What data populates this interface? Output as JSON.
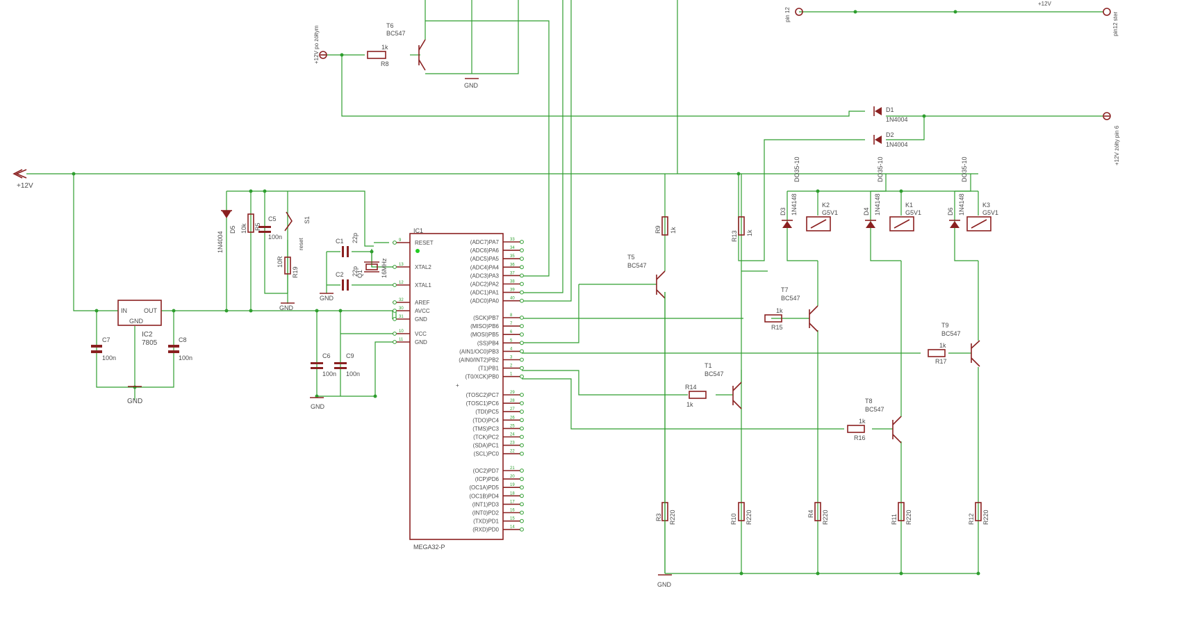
{
  "colors": {
    "wire": "#2e9e2e",
    "part": "#8a2020",
    "text": "#4a4a4a",
    "background": "#ffffff"
  },
  "power": {
    "supply": "+12V",
    "gnd": "GND"
  },
  "connectors": {
    "in_left": "+12V po żółtym",
    "in_right": "+12V żółty pin 6",
    "top_right_a": "pin 12",
    "top_right_b": "pin12 ster",
    "top_right_c": "+12V"
  },
  "ic1": {
    "name": "IC1",
    "part": "MEGA32-P",
    "left_pins": [
      "RESET",
      "XTAL2",
      "XTAL1",
      "AREF",
      "AVCC",
      "GND",
      "VCC",
      "GND"
    ],
    "right_pins": [
      "(ADC7)PA7",
      "(ADC6)PA6",
      "(ADC5)PA5",
      "(ADC4)PA4",
      "(ADC3)PA3",
      "(ADC2)PA2",
      "(ADC1)PA1",
      "(ADC0)PA0",
      "(SCK)PB7",
      "(MISO)PB6",
      "(MOSI)PB5",
      "(SS)PB4",
      "(AIN1/OC0)PB3",
      "(AIN0/INT2)PB2",
      "(T1)PB1",
      "(T0/XCK)PB0",
      "(TOSC2)PC7",
      "(TOSC1)PC6",
      "(TDI)PC5",
      "(TDO)PC4",
      "(TMS)PC3",
      "(TCK)PC2",
      "(SDA)PC1",
      "(SCL)PC0",
      "(OC2)PD7",
      "(ICP)PD6",
      "(OC1A)PD5",
      "(OC1B)PD4",
      "(INT1)PD3",
      "(INT0)PD2",
      "(TXD)PD1",
      "(RXD)PD0"
    ],
    "right_nums": [
      "33",
      "34",
      "35",
      "36",
      "37",
      "38",
      "39",
      "40",
      "8",
      "7",
      "6",
      "5",
      "4",
      "3",
      "2",
      "1",
      "29",
      "28",
      "27",
      "26",
      "25",
      "24",
      "23",
      "22",
      "21",
      "20",
      "19",
      "18",
      "17",
      "16",
      "15",
      "14"
    ],
    "left_nums": [
      "9",
      "13",
      "12",
      "32",
      "30",
      "31",
      "10",
      "11"
    ]
  },
  "ic2": {
    "name": "IC2",
    "part": "7805",
    "pin_in": "IN",
    "pin_out": "OUT",
    "pin_gnd": "GND"
  },
  "passives": {
    "R8": "R8",
    "R8v": "1k",
    "T6": "T6",
    "T6v": "BC547",
    "R5v": "10k",
    "R5": "R5",
    "D5": "D5",
    "D5v": "1N4004",
    "C5": "C5",
    "C5v": "100n",
    "S1": "S1",
    "S1v": "reset",
    "R19": "R19",
    "R19v": "10R",
    "C1": "C1",
    "C1v": "22p",
    "C2": "C2",
    "C2v": "22p",
    "Q1": "Q1",
    "Q1v": "16MHz",
    "C6": "C6",
    "C6v": "100n",
    "C9": "C9",
    "C9v": "100n",
    "C7": "C7",
    "C7v": "100n",
    "C8": "C8",
    "C8v": "100n",
    "D1": "D1",
    "D1v": "1N4004",
    "D2": "D2",
    "D2v": "1N4004",
    "T5": "T5",
    "T5v": "BC547",
    "R9": "R9",
    "R9v": "1k",
    "R13": "R13",
    "R13v": "1k",
    "T7": "T7",
    "T7v": "BC547",
    "R15": "R15",
    "R15v": "1k",
    "T9": "T9",
    "T9v": "BC547",
    "R17": "R17",
    "R17v": "1k",
    "T1": "T1",
    "T1v": "BC547",
    "R14": "R14",
    "R14v": "1k",
    "T8": "T8",
    "T8v": "BC547",
    "R16": "R16",
    "R16v": "1k",
    "K2": "K2",
    "K1": "K1",
    "K3": "K3",
    "Kv": "G5V1",
    "D3": "D3",
    "D4": "D4",
    "D6": "D6",
    "Dsv": "1N4148",
    "DOv": "DO35-10",
    "R3": "R3",
    "R10": "R10",
    "R4": "R4",
    "R11": "R11",
    "R12": "R12",
    "R220": "R220"
  }
}
